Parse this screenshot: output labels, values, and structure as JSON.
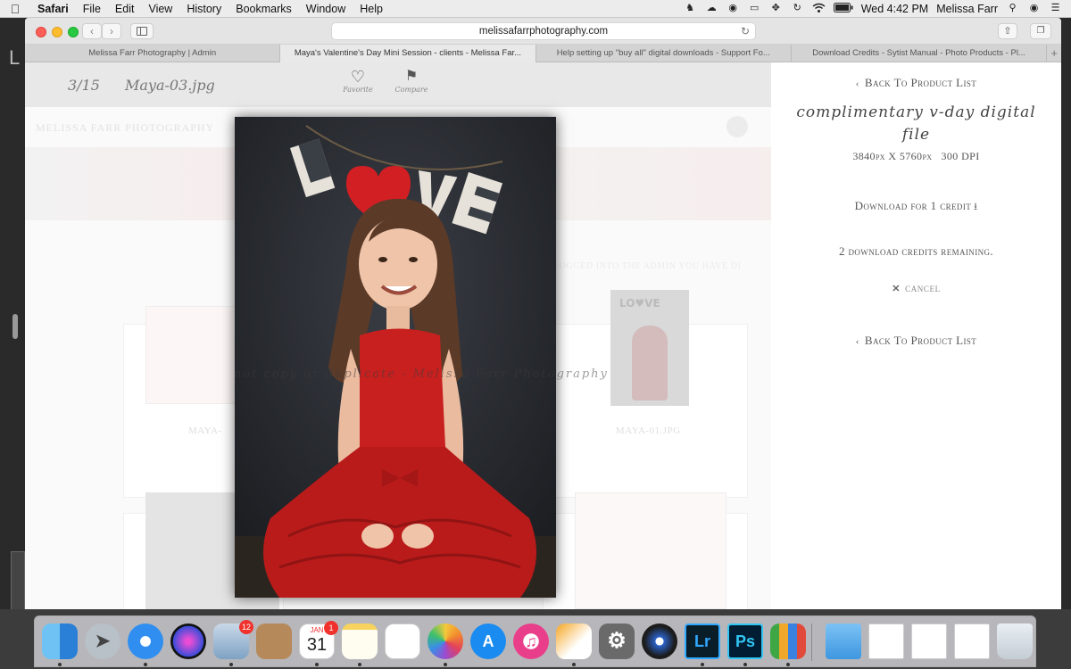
{
  "menubar": {
    "app_name": "Safari",
    "menus": [
      "File",
      "Edit",
      "View",
      "History",
      "Bookmarks",
      "Window",
      "Help"
    ],
    "clock": "Wed 4:42 PM",
    "user_name": "Melissa Farr",
    "status_icons": [
      "evernote-icon",
      "creative-cloud-icon",
      "backup-icon",
      "airplay-icon",
      "grid-icon",
      "time-machine-icon",
      "wifi-icon",
      "battery-icon"
    ]
  },
  "browser": {
    "url": "melissafarrphotography.com",
    "tabs": [
      {
        "label": "Melissa Farr Photography | Admin",
        "active": false
      },
      {
        "label": "Maya's Valentine's Day Mini Session - clients - Melissa Far...",
        "active": true
      },
      {
        "label": "Help setting up \"buy all\" digital downloads - Support Fo...",
        "active": false
      },
      {
        "label": "Download Credits - Sytist Manual - Photo Products - Pl...",
        "active": false
      }
    ],
    "new_tab_label": "+"
  },
  "lightbox": {
    "counter": "3/15",
    "image_name": "Maya-03.jpg",
    "favorite_label": "Favorite",
    "compare_label": "Compare",
    "watermark_text": "not copy or duplicate - Melissa Farr Photography"
  },
  "background_site": {
    "site_title": "MELISSA FARR PHOTOGRAPHY",
    "admin_notice": "LOGGED INTO THE ADMIN YOU HAVE DI",
    "thumb_label_a": "MAYA-",
    "thumb_label_b": "MAYA-01.JPG"
  },
  "panel": {
    "back_link_top": "Back To Product List",
    "product_title": "complimentary v-day digital file",
    "dimensions": "3840px X 5760px",
    "dpi": "300 DPI",
    "download_label": "Download for 1 credit",
    "credits_remaining": "2 download credits remaining.",
    "cancel_label": "cancel",
    "back_link_bottom": "Back To Product List"
  },
  "dock": {
    "items": [
      {
        "name": "finder",
        "running": true
      },
      {
        "name": "launchpad",
        "running": false
      },
      {
        "name": "safari",
        "running": true
      },
      {
        "name": "siri",
        "running": false
      },
      {
        "name": "mail",
        "running": true,
        "badge": "12"
      },
      {
        "name": "contacts",
        "running": false
      },
      {
        "name": "calendar",
        "running": true,
        "badge": "1",
        "month": "JAN",
        "day": "31"
      },
      {
        "name": "notes",
        "running": true
      },
      {
        "name": "reminders",
        "running": false
      },
      {
        "name": "photos",
        "running": true
      },
      {
        "name": "app-store",
        "running": false
      },
      {
        "name": "itunes",
        "running": false
      },
      {
        "name": "pages",
        "running": true
      },
      {
        "name": "system-preferences",
        "running": false
      },
      {
        "name": "aperture",
        "running": false
      },
      {
        "name": "lightroom",
        "running": true,
        "label": "Lr"
      },
      {
        "name": "photoshop",
        "running": true,
        "label": "Ps"
      },
      {
        "name": "numbers",
        "running": true
      }
    ]
  },
  "colors": {
    "photo_dress": "#c8201f",
    "photo_backdrop": "#25282d",
    "panel_text": "#555555",
    "lr_blue": "#31a8ff",
    "lr_bg": "#0a1e2a"
  }
}
